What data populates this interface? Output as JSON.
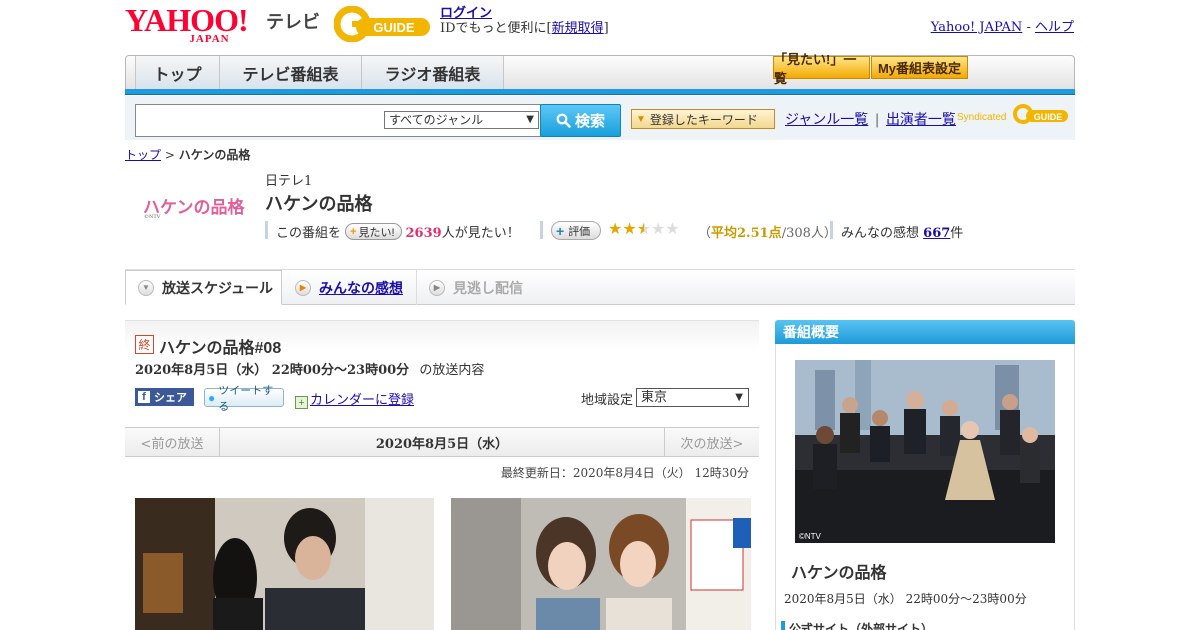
{
  "header": {
    "yahoo_logo": "YAHOO!",
    "yahoo_logo_sub": "JAPAN",
    "tv_label": "テレビ",
    "gguide_logo": "G-GUIDE",
    "login": "ログイン",
    "login_note_prefix": "IDでもっと便利に[",
    "register": "新規取得",
    "login_note_suffix": "]",
    "yahoo_japan": "Yahoo! JAPAN",
    "sep": " - ",
    "help": "ヘルプ"
  },
  "nav": {
    "tabs": [
      "トップ",
      "テレビ番組表",
      "ラジオ番組表"
    ],
    "want_list": "「見たい!」一覧",
    "my_schedule": "My番組表設定"
  },
  "search": {
    "placeholder": "",
    "genre_selected": "すべてのジャンル",
    "search_button": "検索",
    "keyword_button": "登録したキーワード",
    "genre_list": "ジャンル一覧",
    "divider": "|",
    "cast_list": "出演者一覧",
    "syndicated": "Syndicated"
  },
  "breadcrumb": {
    "top": "トップ",
    "sep": " > ",
    "current": "ハケンの品格"
  },
  "program": {
    "logo_text": "ハケンの品格",
    "logo_small": "©NTV",
    "channel": "日テレ1",
    "title": "ハケンの品格",
    "want_prefix": "この番組を",
    "want_button": "見たい!",
    "want_count": "2639",
    "want_suffix": "人が見たい！",
    "rate_button": "評価",
    "rating_value": 2.51,
    "avg_prefix": "（",
    "avg_label": "平均2.51点",
    "avg_suffix": "/308人）",
    "impressions_prefix": "みんなの感想",
    "impressions_count": "667",
    "impressions_suffix": "件"
  },
  "tabs": {
    "schedule": "放送スケジュール",
    "reviews": "みんなの感想",
    "streaming": "見逃し配信"
  },
  "episode": {
    "end_badge": "終",
    "title": "ハケンの品格#08",
    "time": "2020年8月5日（水） 22時00分～23時00分",
    "time_suffix": "の放送内容",
    "share": "シェア",
    "tweet": "ツイートする",
    "calendar": "カレンダーに登録",
    "region_label": "地域設定",
    "region_selected": "東京",
    "prev": "<前の放送",
    "current_date": "2020年8月5日（水）",
    "next": "次の放送>",
    "updated": "最終更新日：2020年8月4日（火） 12時30分"
  },
  "sidebar": {
    "heading": "番組概要",
    "photo_credit": "©NTV",
    "title": "ハケンの品格",
    "time": "2020年8月5日（水） 22時00分～23時00分",
    "official_label": "公式サイト（外部サイト）"
  },
  "colors": {
    "accent": "#1e9be0",
    "link": "#1a0dab",
    "want_count": "#e0306c",
    "rating": "#c89b00"
  }
}
